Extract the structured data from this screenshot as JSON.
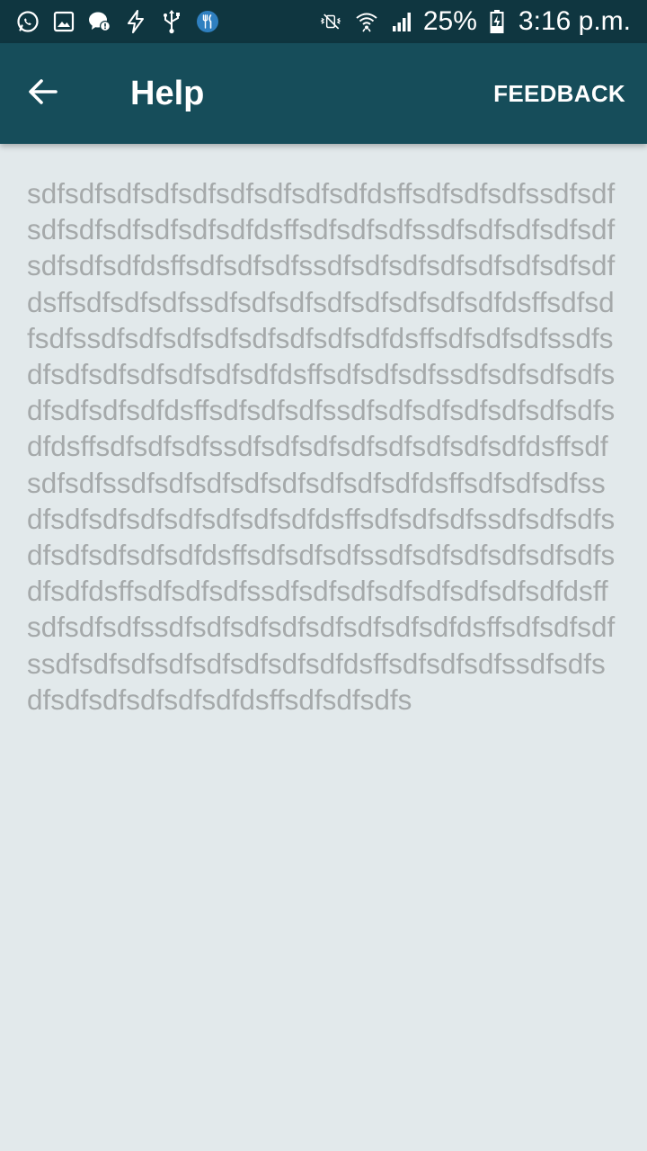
{
  "status_bar": {
    "battery": "25%",
    "time": "3:16 p.m.",
    "left_icons": [
      "whatsapp-icon",
      "image-icon",
      "chat-bubble-icon",
      "flash-icon",
      "usb-icon",
      "restaurant-icon"
    ],
    "right_icons": [
      "mute-vibrate-icon",
      "wifi-icon",
      "signal-icon",
      "battery-charging-icon"
    ]
  },
  "app_bar": {
    "title": "Help",
    "feedback_label": "FEEDBACK",
    "back_icon": "arrow-back-icon",
    "background": "#164d5a"
  },
  "content": {
    "text": "sdfsdfsdfsdfsdfsdfsdfsdfsdfdsffsdfsdfsdfssdfsdfsdfsdfsdfsdfsdfsdfdsffsdfsdfsdfssdfsdfsdfsdfsdfsdfsdfsdfdsffsdfsdfsdfssdfsdfsdfsdfsdfsdfsdfsdfdsffsdfsdfsdfssdfsdfsdfsdfsdfsdfsdfsdfdsffsdfsdfsdfssdfsdfsdfsdfsdfsdfsdfsdfdsffsdfsdfsdfssdfsdfsdfsdfsdfsdfsdfsdfdsffsdfsdfsdfssdfsdfsdfsdfsdfsdfsdfsdfdsffsdfsdfsdfssdfsdfsdfsdfsdfsdfsdfsdfdsffsdfsdfsdfssdfsdfsdfsdfsdfsdfsdfsdfdsffsdfsdfsdfssdfsdfsdfsdfsdfsdfsdfsdfdsffsdfsdfsdfssdfsdfsdfsdfsdfsdfsdfsdfdsffsdfsdfsdfssdfsdfsdfsdfsdfsdfsdfsdfdsffsdfsdfsdfssdfsdfsdfsdfsdfsdfsdfsdfdsffsdfsdfsdfssdfsdfsdfsdfsdfsdfsdfsdfdsffsdfsdfsdfssdfsdfsdfsdfsdfsdfsdfsdfdsffsdfsdfsdfssdfsdfsdfsdfsdfsdfsdfsdfdsffsdfsdfsdfssdfsdfsdfsdfsdfsdfsdfsdfdsffsdfsdfsdfs"
  }
}
